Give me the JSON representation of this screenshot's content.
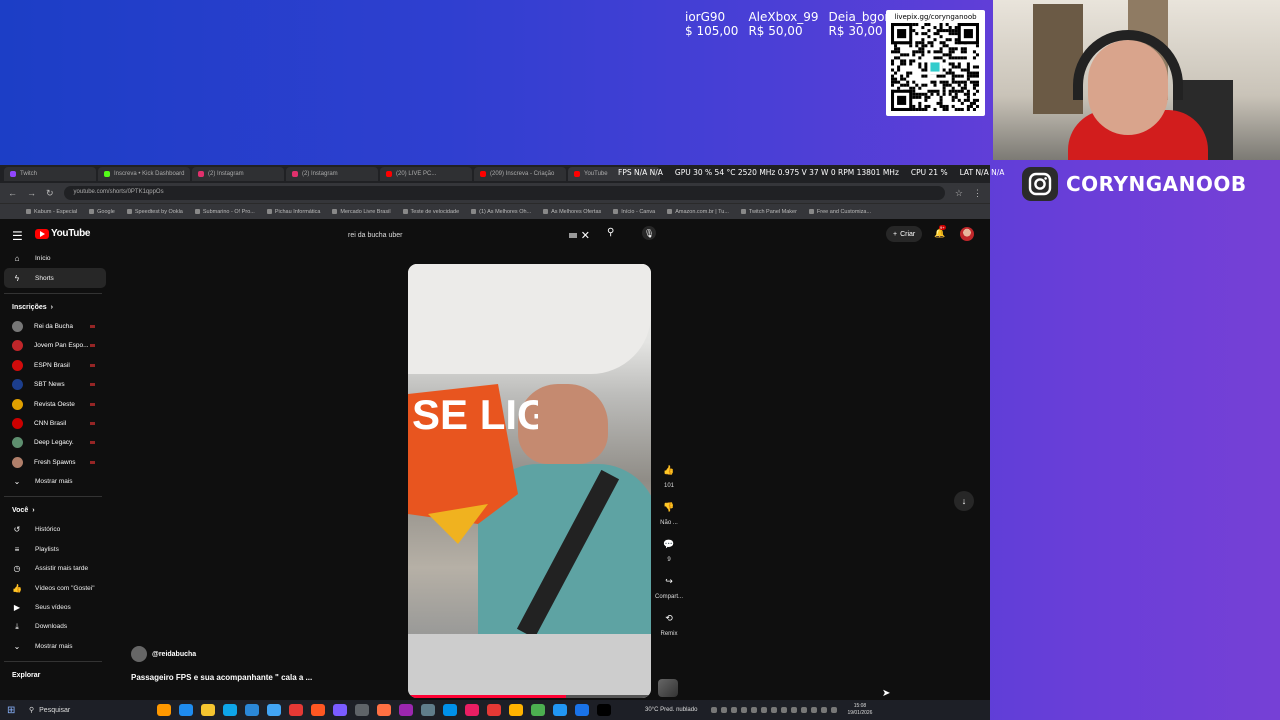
{
  "overlay": {
    "donations": [
      {
        "name": "iorG90",
        "amount": "$ 105,00"
      },
      {
        "name": "AleXbox_99",
        "amount": "R$ 50,00"
      },
      {
        "name": "Deia_bgon",
        "amount": "R$ 30,00"
      }
    ],
    "qr_url": "livepix.gg/corynganoob",
    "instagram_handle": "CORYNGANOOB"
  },
  "browser": {
    "tabs": [
      {
        "label": "Twitch",
        "color": "#9146ff"
      },
      {
        "label": "Inscreva • Kick Dashboard",
        "color": "#53fc18"
      },
      {
        "label": "(2) Instagram",
        "color": "#e1306c"
      },
      {
        "label": "(2) Instagram",
        "color": "#e1306c"
      },
      {
        "label": "(20) LIVE PC...",
        "color": "#ff0000"
      },
      {
        "label": "(209) Inscreva - Criação",
        "color": "#ff0000"
      },
      {
        "label": "YouTube",
        "color": "#ff0000"
      }
    ],
    "perf": {
      "fps": "FPS N/A N/A",
      "gpu": "GPU 30 % 54 °C 2520 MHz 0.975 V 37 W 0 RPM 13801 MHz",
      "cpu": "CPU 21 %",
      "lat": "LAT N/A N/A"
    },
    "url": "youtube.com/shorts/0PTK1qppOs",
    "bookmarks": [
      "Kabum - Especial",
      "Google",
      "Speedtest by Ookla",
      "Submarino - O! Pro...",
      "Pichau Informática",
      "Mercado Livre Brasil",
      "Teste de velocidade",
      "(1) As Melhores Oh...",
      "As Melhores Ofertas",
      "Início - Canva",
      "Amazon.com.br | Tu...",
      "Twitch Panel Maker",
      "Free and Customiza..."
    ]
  },
  "youtube": {
    "logo": "YouTube",
    "search_query": "rei da bucha uber",
    "create_label": "Criar",
    "notif_count": "9+",
    "nav": [
      {
        "label": "Início",
        "icon": "home-icon",
        "glyph": "⌂"
      },
      {
        "label": "Shorts",
        "icon": "shorts-icon",
        "glyph": "ϟ"
      }
    ],
    "subs_title": "Inscrições",
    "subscriptions": [
      {
        "label": "Rei da Bucha",
        "color": "#777"
      },
      {
        "label": "Jovem Pan Espo...",
        "color": "#c0262a"
      },
      {
        "label": "ESPN Brasil",
        "color": "#d10b0b"
      },
      {
        "label": "SBT News",
        "color": "#1c3e8c"
      },
      {
        "label": "Revista Oeste",
        "color": "#e0a000"
      },
      {
        "label": "CNN Brasil",
        "color": "#cc0000"
      },
      {
        "label": "Deep Legacy.",
        "color": "#5e8f6f"
      },
      {
        "label": "Fresh Spawns",
        "color": "#b07f6a"
      }
    ],
    "show_more": "Mostrar mais",
    "you_title": "Você",
    "you_items": [
      {
        "label": "Histórico",
        "icon": "history-icon",
        "glyph": "↺"
      },
      {
        "label": "Playlists",
        "icon": "playlists-icon",
        "glyph": "≡"
      },
      {
        "label": "Assistir mais tarde",
        "icon": "watch-later-icon",
        "glyph": "◷"
      },
      {
        "label": "Vídeos com \"Gostei\"",
        "icon": "like-icon",
        "glyph": "👍"
      },
      {
        "label": "Seus vídeos",
        "icon": "your-videos-icon",
        "glyph": "▶"
      },
      {
        "label": "Downloads",
        "icon": "download-icon",
        "glyph": "⤓"
      }
    ],
    "show_more_2": "Mostrar mais",
    "explore_title": "Explorar",
    "short": {
      "channel": "@reidabucha",
      "title": "Passageiro FPS e sua acompanhante \" cala a ...",
      "overlay_text": "SE LIGA",
      "progress": 0.65,
      "actions": [
        {
          "icon": "thumbs-up-icon",
          "glyph": "👍",
          "label": "101"
        },
        {
          "icon": "thumbs-down-icon",
          "glyph": "👎",
          "label": "Não ..."
        },
        {
          "icon": "comment-icon",
          "glyph": "💬",
          "label": "9"
        },
        {
          "icon": "share-icon",
          "glyph": "↪",
          "label": "Compart..."
        },
        {
          "icon": "remix-icon",
          "glyph": "⟲",
          "label": "Remix"
        }
      ]
    }
  },
  "taskbar": {
    "search": "Pesquisar",
    "weather": "30°C  Pred. nublado",
    "time": "15:08",
    "date": "19/01/2026",
    "apps": [
      "#ff9800",
      "#1f8cf0",
      "#f4c430",
      "#0ea5e9",
      "#2b88d8",
      "#42a5f5",
      "#e53935",
      "#ff5722",
      "#7b5cff",
      "#5f6368",
      "#ff7043",
      "#9c27b0",
      "#607d8b",
      "#0091ea",
      "#e91e63",
      "#e53935",
      "#ffb300",
      "#4caf50",
      "#2196f3",
      "#1a73e8",
      "#000000"
    ]
  }
}
